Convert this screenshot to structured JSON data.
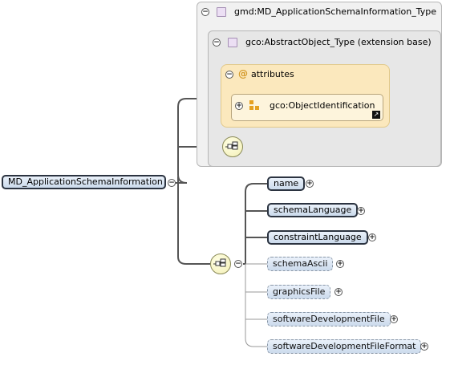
{
  "root_element": "MD_ApplicationSchemaInformation",
  "complex_type": "gmd:MD_ApplicationSchemaInformation_Type",
  "extension_base": "gco:AbstractObject_Type (extension base)",
  "attributes_label": "attributes",
  "attribute_group": "gco:ObjectIdentification",
  "elements": [
    {
      "name": "name",
      "required": true
    },
    {
      "name": "schemaLanguage",
      "required": true
    },
    {
      "name": "constraintLanguage",
      "required": true
    },
    {
      "name": "schemaAscii",
      "required": false
    },
    {
      "name": "graphicsFile",
      "required": false
    },
    {
      "name": "softwareDevelopmentFile",
      "required": false
    },
    {
      "name": "softwareDevelopmentFileFormat",
      "required": false
    }
  ],
  "icons": {
    "expand": "plus-circle-icon",
    "collapse": "minus-circle-icon",
    "complex_type": "complex-type-icon",
    "attribute": "attribute-at-icon",
    "attribute_group": "attribute-group-icon",
    "sequence": "sequence-compositor-icon",
    "external_link": "external-link-icon"
  },
  "colors": {
    "element_fill": "#cbdaec",
    "attribute_fill": "#fbe8bd",
    "type_box_fill": "#f1f1f1",
    "connector": "#555555"
  }
}
